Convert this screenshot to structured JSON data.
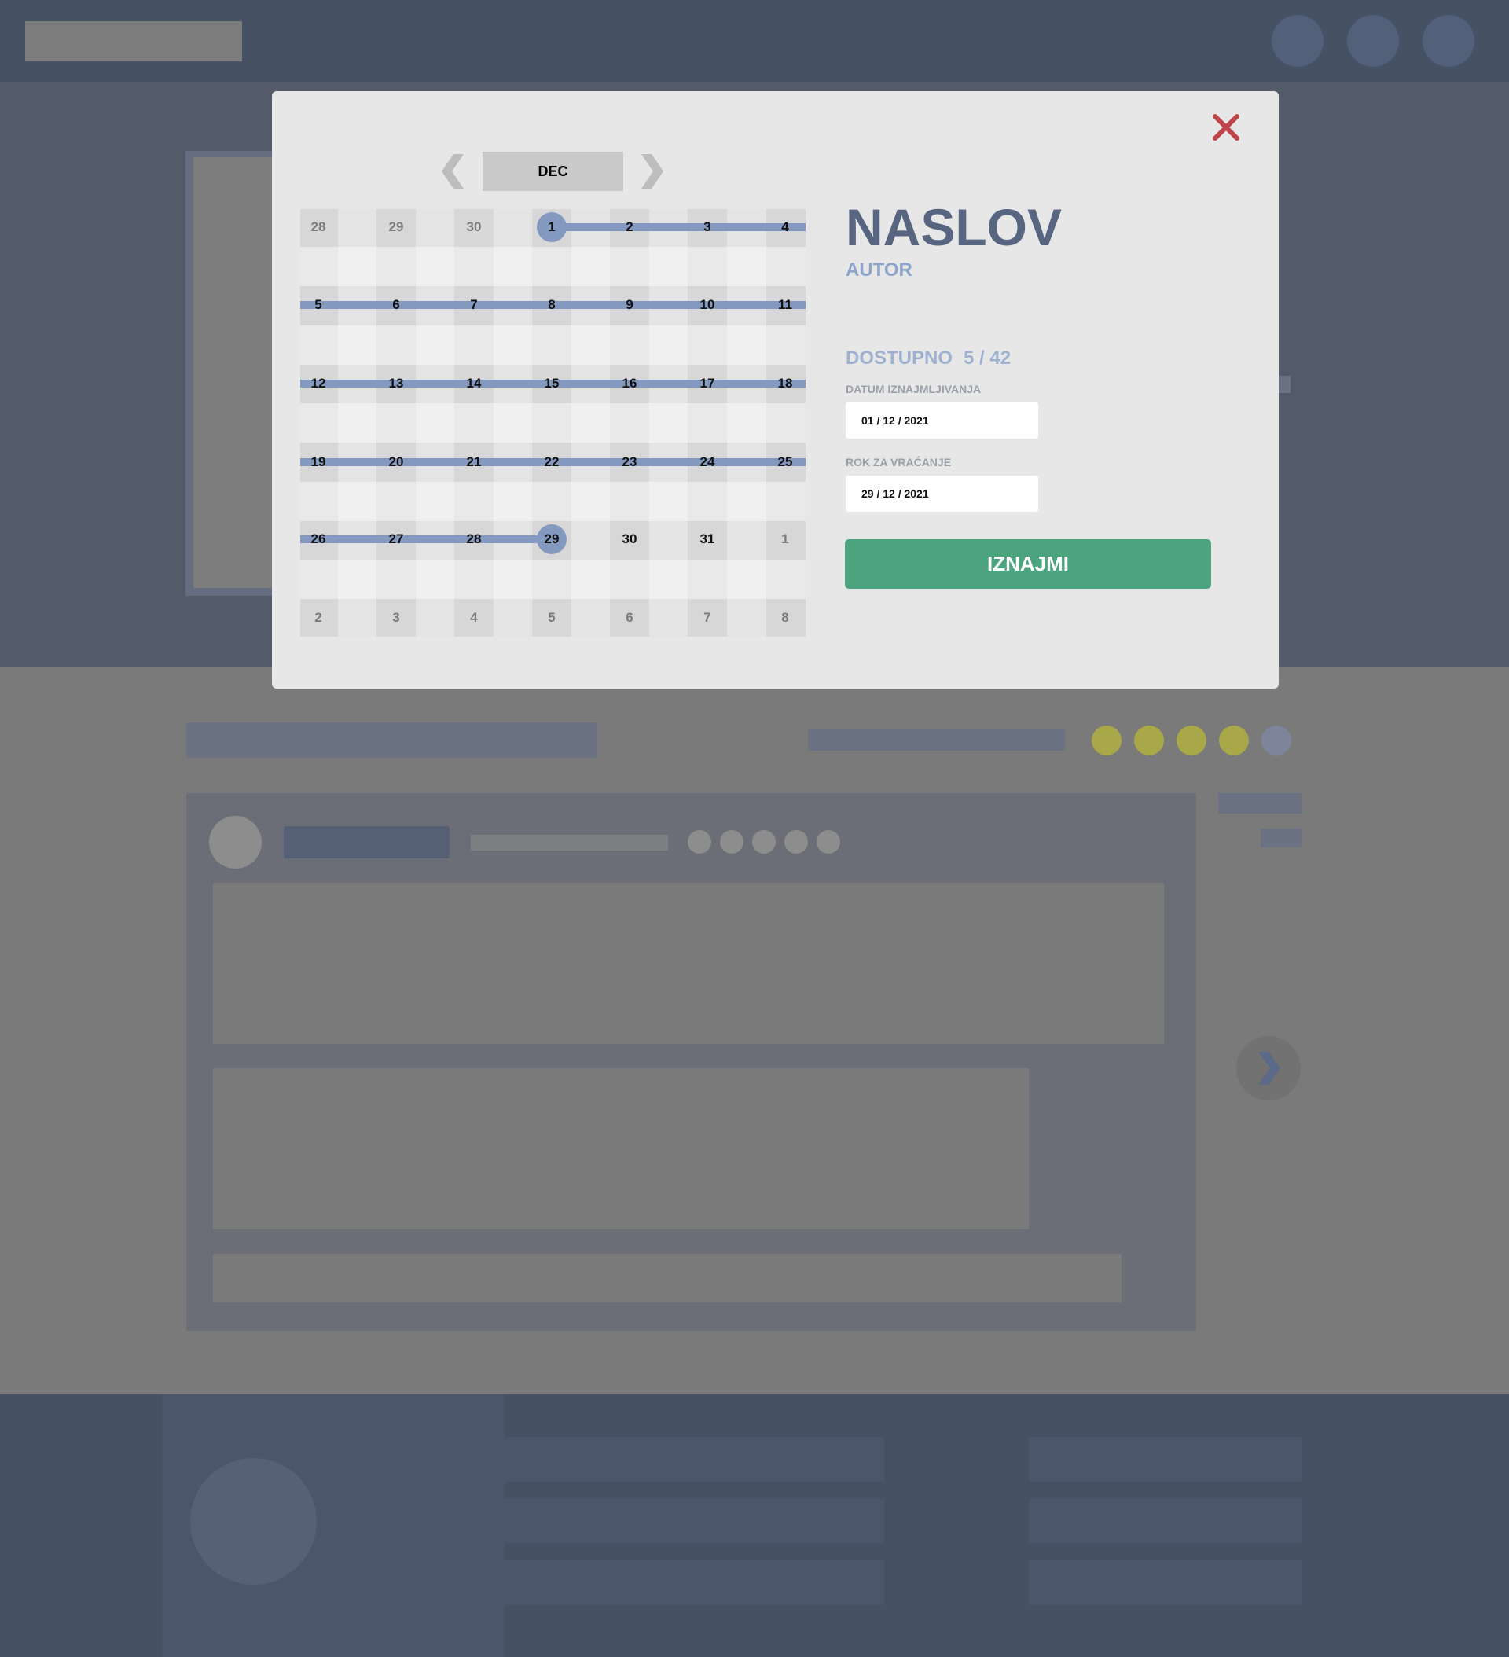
{
  "modal": {
    "month": "DEC",
    "calendar": {
      "weeks": [
        [
          "28",
          "29",
          "30",
          "1",
          "2",
          "3",
          "4"
        ],
        [
          "5",
          "6",
          "7",
          "8",
          "9",
          "10",
          "11"
        ],
        [
          "12",
          "13",
          "14",
          "15",
          "16",
          "17",
          "18"
        ],
        [
          "19",
          "20",
          "21",
          "22",
          "23",
          "24",
          "25"
        ],
        [
          "26",
          "27",
          "28",
          "29",
          "30",
          "31",
          "1"
        ],
        [
          "2",
          "3",
          "4",
          "5",
          "6",
          "7",
          "8"
        ]
      ],
      "range_start_day": "1",
      "range_end_day": "29"
    },
    "book": {
      "title": "NASLOV",
      "author": "AUTOR"
    },
    "availability": {
      "label": "DOSTUPNO",
      "value": "5 / 42"
    },
    "rent_date": {
      "label": "DATUM IZNAJMLJIVANJA",
      "value": "01 / 12 / 2021"
    },
    "return_date": {
      "label": "ROK ZA VRAĆANJE",
      "value": "29 / 12 / 2021"
    },
    "rent_button_label": "IZNAJMI"
  },
  "background": {
    "rating_filled": 4,
    "rating_total": 5
  },
  "colors": {
    "accent_blue": "#8499c0",
    "title_color": "#576580",
    "button_green": "#4ba47d",
    "close_red": "#c0454b",
    "rating_yellow": "#a9a848"
  }
}
